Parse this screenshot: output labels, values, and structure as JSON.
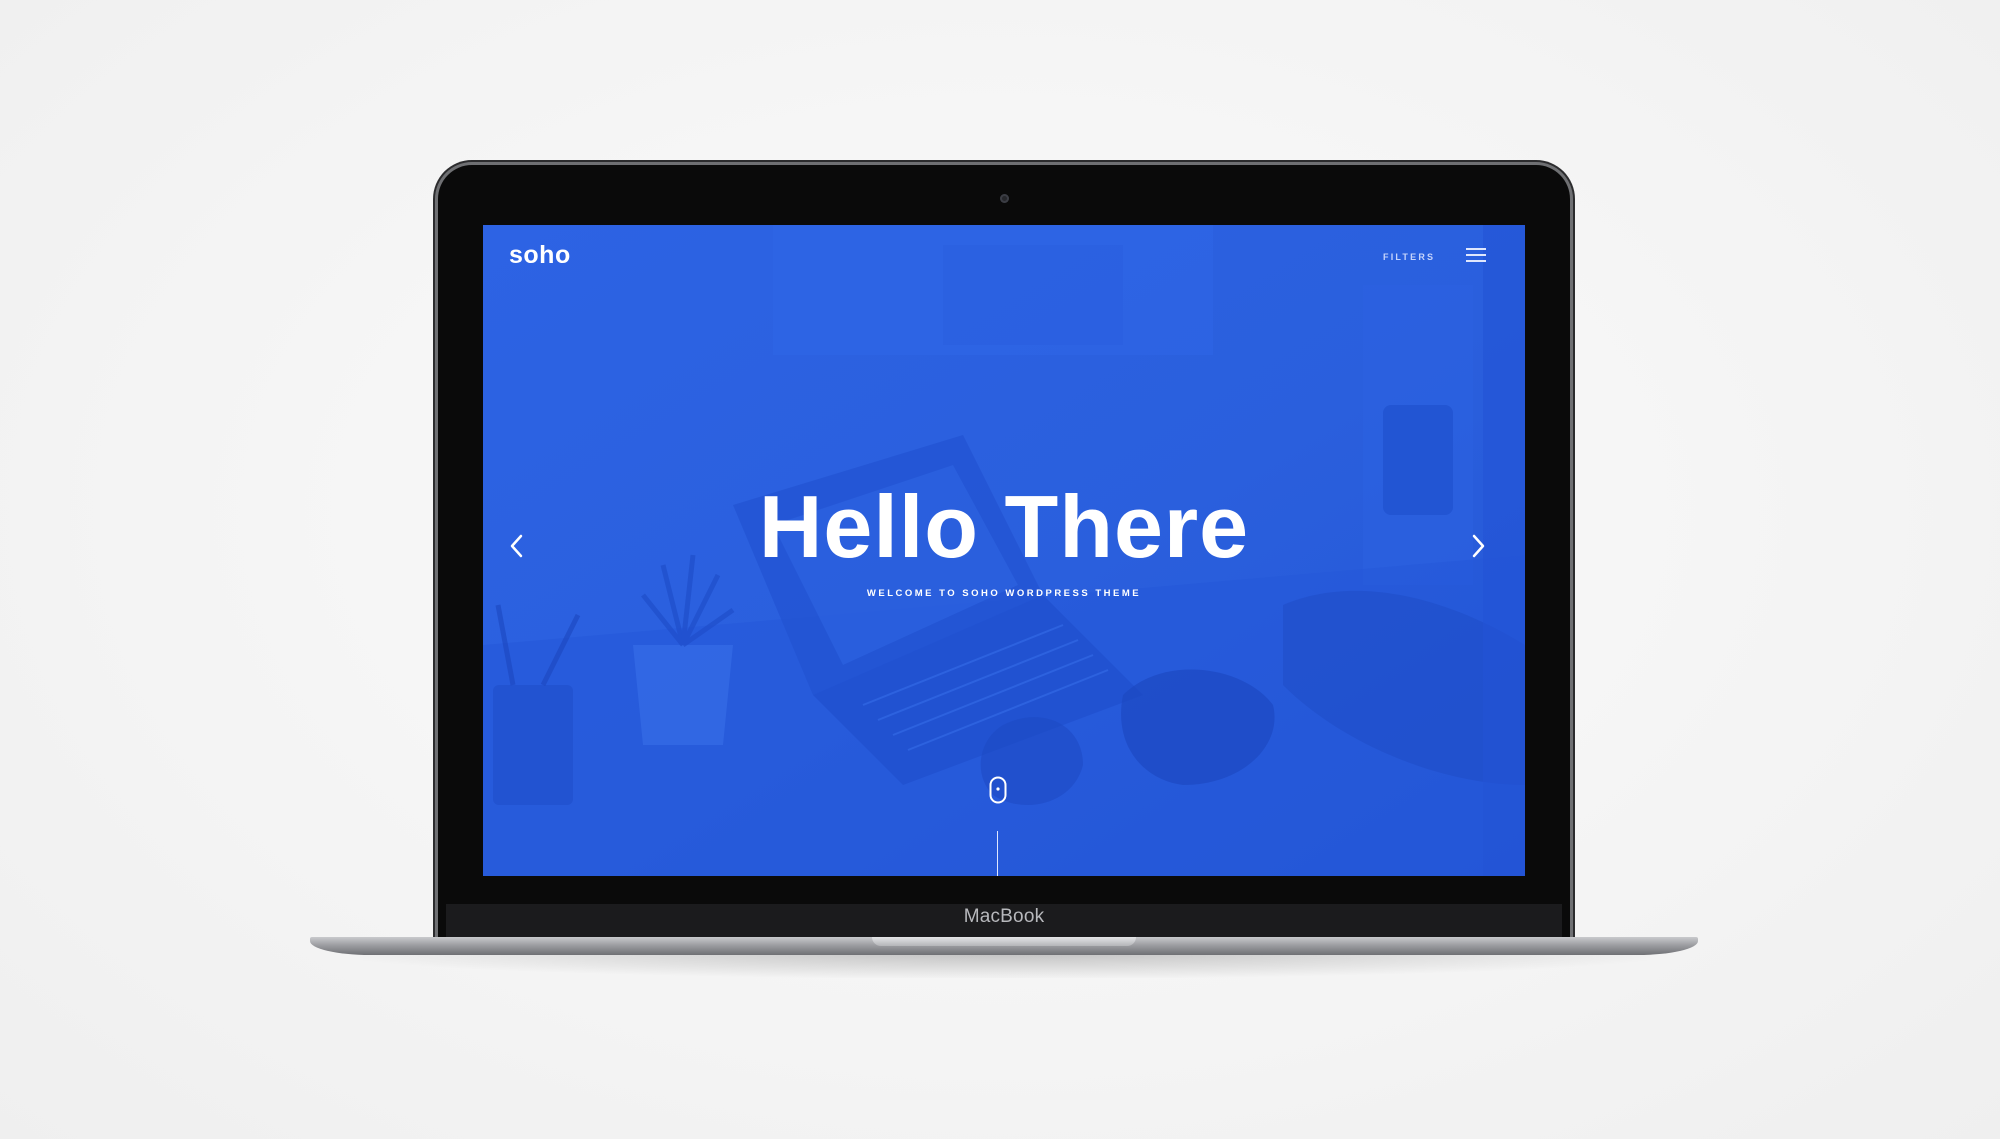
{
  "device": {
    "label": "MacBook"
  },
  "site": {
    "logo": "soho",
    "nav": {
      "filters_label": "FILTERS",
      "menu_icon": "hamburger-menu-icon"
    },
    "hero": {
      "title": "Hello There",
      "subtitle": "WELCOME TO SOHO WORDPRESS THEME",
      "prev_icon": "chevron-left-icon",
      "next_icon": "chevron-right-icon",
      "scroll_icon": "mouse-scroll-icon"
    }
  },
  "colors": {
    "hero_background": "#2a62e0",
    "text": "#ffffff",
    "page_background": "#f6f6f6"
  }
}
